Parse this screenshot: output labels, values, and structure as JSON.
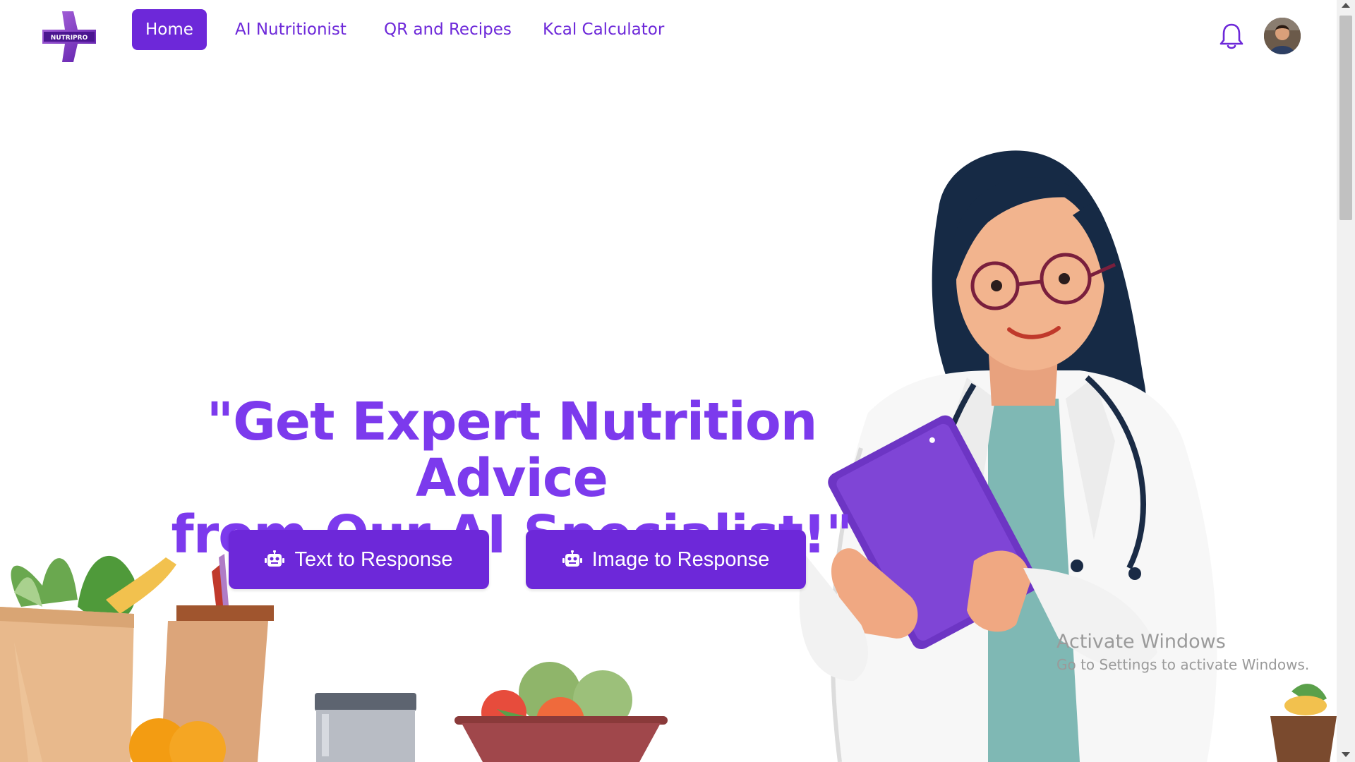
{
  "nav": {
    "logo_text": "NUTRIPRO",
    "links": [
      "Home",
      "AI Nutritionist",
      "QR and Recipes",
      "Kcal Calculator"
    ],
    "active": "Home"
  },
  "hero": {
    "title_line1": "\"Get Expert Nutrition Advice",
    "title_line2": "from Our AI Specialist!\"",
    "buttons": {
      "text_response": "Text to Response",
      "image_response": "Image to Response"
    }
  },
  "watermark": {
    "line1": "Activate Windows",
    "line2": "Go to Settings to activate Windows."
  },
  "colors": {
    "brand": "#6d28d9",
    "title": "#7c3aed"
  },
  "icons": [
    "bell-icon",
    "robot-icon",
    "avatar"
  ]
}
